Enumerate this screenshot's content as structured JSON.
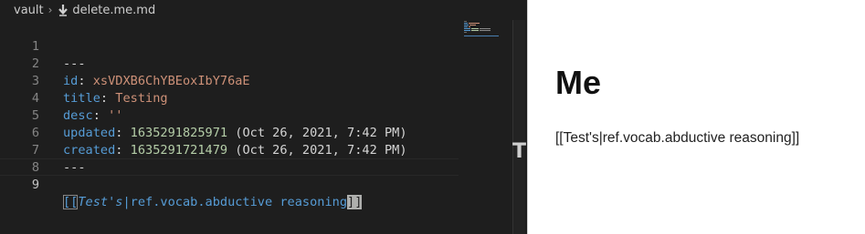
{
  "breadcrumb": {
    "folder": "vault",
    "file": "delete.me.md"
  },
  "editor": {
    "lines": [
      {
        "n": "1",
        "text": "---"
      },
      {
        "n": "2",
        "key": "id",
        "value": "xsVDXB6ChYBEoxIbY76aE"
      },
      {
        "n": "3",
        "key": "title",
        "value": "Testing"
      },
      {
        "n": "4",
        "key": "desc",
        "value": "''"
      },
      {
        "n": "5",
        "key": "updated",
        "value": "1635291825971",
        "comment": "(Oct 26, 2021, 7:42 PM)"
      },
      {
        "n": "6",
        "key": "created",
        "value": "1635291721479",
        "comment": "(Oct 26, 2021, 7:42 PM)"
      },
      {
        "n": "7",
        "text": "---"
      },
      {
        "n": "8",
        "text": ""
      },
      {
        "n": "9",
        "link_open": "[[",
        "link_alias": "Test's",
        "link_pipe": "|",
        "link_target": "ref.vocab.abductive reasoning",
        "link_close": "]]"
      }
    ],
    "scroll_glyph": "T"
  },
  "preview": {
    "title": "Me",
    "body": "[[Test's|ref.vocab.abductive reasoning]]"
  },
  "colors": {
    "editor_bg": "#1e1e1e",
    "key": "#569cd6",
    "string": "#ce9178",
    "number": "#b5cea8",
    "preview_bg": "#ffffff"
  }
}
